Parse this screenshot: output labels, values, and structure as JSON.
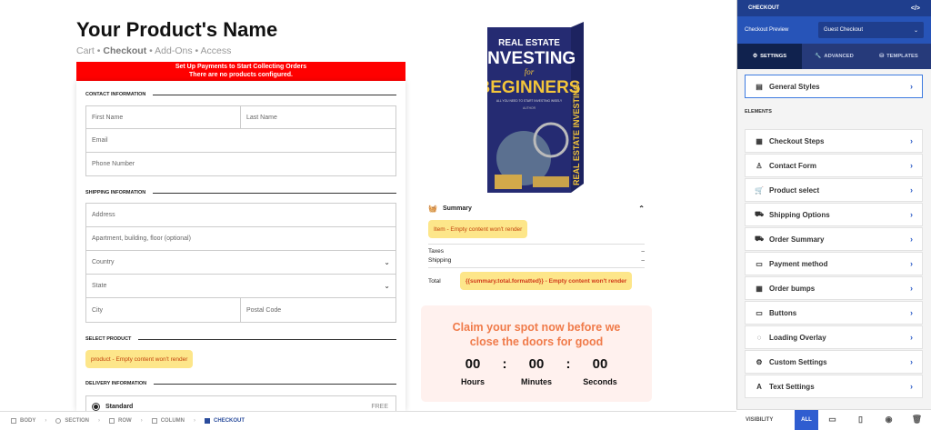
{
  "product": {
    "title": "Your Product's Name",
    "steps_cart": "Cart",
    "steps_bullet1": " • ",
    "steps_checkout": "Checkout",
    "steps_rest": " • Add-Ons • Access"
  },
  "alert": {
    "line1": "Set Up Payments to Start Collecting Orders",
    "line2": "There are no products configured."
  },
  "form": {
    "contact_heading": "CONTACT INFORMATION",
    "first_name": "First Name",
    "last_name": "Last Name",
    "email": "Email",
    "phone": "Phone Number",
    "shipping_heading": "SHIPPING INFORMATION",
    "address": "Address",
    "address2": "Apartment, building, floor (optional)",
    "country": "Country",
    "state": "State",
    "city": "City",
    "postal": "Postal Code",
    "select_product_heading": "SELECT PRODUCT",
    "product_warning": "product - Empty content won't render",
    "delivery_heading": "DELIVERY INFORMATION",
    "delivery_option": "Standard",
    "delivery_price": "FREE"
  },
  "book": {
    "line1": "REAL ESTATE",
    "line2": "INVESTING",
    "line3": "for",
    "line4": "BEGINNERS",
    "tagline": "ALL YOU NEED TO START INVESTING WISELY",
    "author": "AUTHOR",
    "spine": "REAL ESTATE INVESTING"
  },
  "summary": {
    "heading": "Summary",
    "item_warning": "Item - Empty content won't render",
    "taxes_label": "Taxes",
    "taxes_value": "–",
    "shipping_label": "Shipping",
    "shipping_value": "–",
    "total_label": "Total",
    "total_warning": "{{summary.total.formatted}} - Empty content won't render"
  },
  "countdown": {
    "title_line1": "Claim your spot now before we",
    "title_line2": "close the doors for good",
    "hours": "00",
    "minutes": "00",
    "seconds": "00",
    "sep": ":",
    "hours_label": "Hours",
    "minutes_label": "Minutes",
    "seconds_label": "Seconds"
  },
  "breadcrumbs": [
    "BODY",
    "SECTION",
    "ROW",
    "COLUMN",
    "CHECKOUT"
  ],
  "panel": {
    "title": "CHECKOUT",
    "code_icon": "</>",
    "preview_label": "Checkout Preview",
    "preview_value": "Guest Checkout",
    "tabs": [
      "SETTINGS",
      "ADVANCED",
      "TEMPLATES"
    ],
    "general_styles": "General Styles",
    "elements_heading": "ELEMENTS",
    "items": [
      "Checkout Steps",
      "Contact Form",
      "Product select",
      "Shipping Options",
      "Order Summary",
      "Payment method",
      "Order bumps",
      "Buttons",
      "Loading Overlay",
      "Custom Settings",
      "Text Settings"
    ],
    "visibility_label": "VISIBILITY",
    "visibility_all": "ALL"
  },
  "icons": {
    "gear": "gear-icon",
    "wrench": "wrench-icon",
    "templates": "templates-icon",
    "basket": "basket-icon",
    "chevron_up": "chevron-up-icon",
    "radio": "radio-icon",
    "desktop": "desktop-icon",
    "mobile": "mobile-icon",
    "eye": "eye-icon",
    "trash": "trash-icon"
  },
  "colors": {
    "alert_red": "#ff0000",
    "warning_bg": "#fde68a",
    "warning_text": "#c2410c",
    "countdown_title": "#f07b4a",
    "panel_header": "#1f3e8d",
    "accent_blue": "#2f5dd0"
  }
}
